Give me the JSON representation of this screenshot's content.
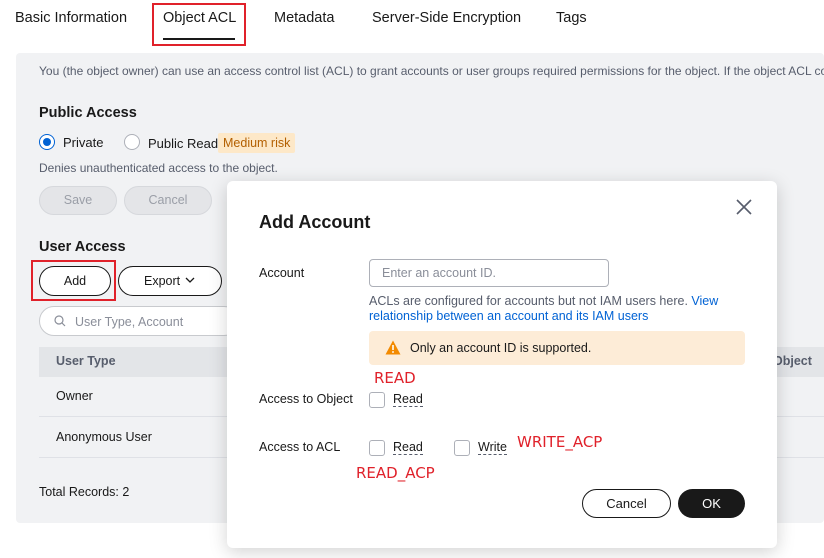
{
  "tabs": [
    {
      "label": "Basic Information"
    },
    {
      "label": "Object ACL"
    },
    {
      "label": "Metadata"
    },
    {
      "label": "Server-Side Encryption"
    },
    {
      "label": "Tags"
    }
  ],
  "page": {
    "description": "You (the object owner) can use an access control list (ACL) to grant accounts or user groups required permissions for the object. If the object ACL co"
  },
  "public_access": {
    "title": "Public Access",
    "private_label": "Private",
    "public_read_label": "Public Read",
    "risk_badge": "Medium risk",
    "hint": "Denies unauthenticated access to the object.",
    "save_label": "Save",
    "cancel_label": "Cancel"
  },
  "user_access": {
    "title": "User Access",
    "add_label": "Add",
    "export_label": "Export",
    "search_placeholder": "User Type, Account",
    "columns": [
      "User Type",
      "Object"
    ],
    "rows": [
      {
        "user_type": "Owner"
      },
      {
        "user_type": "Anonymous User"
      }
    ],
    "total": "Total Records: 2"
  },
  "modal": {
    "title": "Add Account",
    "account_label": "Account",
    "account_placeholder": "Enter an account ID.",
    "note_text": "ACLs are configured for accounts but not IAM users here. ",
    "note_link": "View relationship between an account and its IAM users",
    "warning": "Only an account ID is supported.",
    "access_object_label": "Access to Object",
    "access_acl_label": "Access to ACL",
    "read_label": "Read",
    "acl_read_label": "Read",
    "acl_write_label": "Write",
    "cancel_label": "Cancel",
    "ok_label": "OK"
  },
  "annotations": {
    "read": "READ",
    "read_acp": "READ_ACP",
    "write_acp": "WRITE_ACP"
  },
  "colors": {
    "accent": "#0062d4",
    "annotation": "#e0212a",
    "warning_bg": "#fdecd7"
  }
}
